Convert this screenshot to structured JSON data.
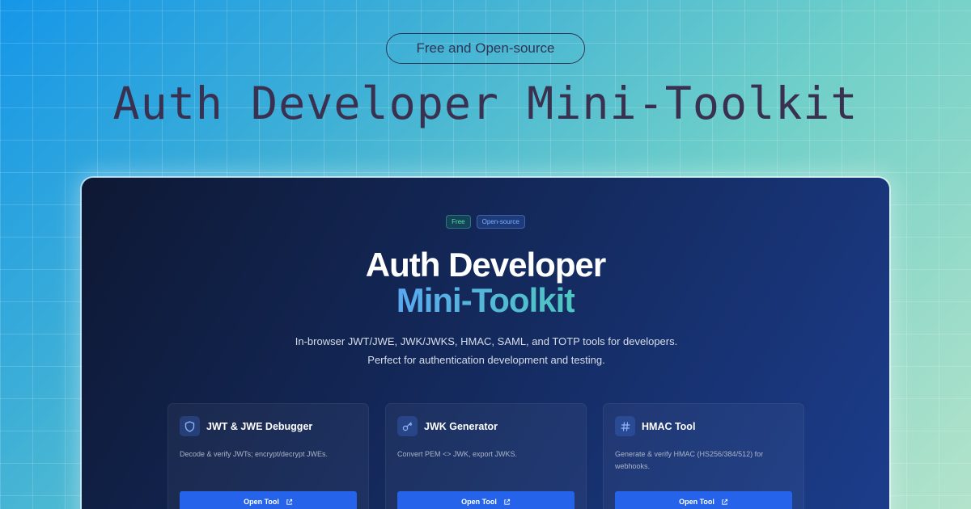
{
  "banner": {
    "pill_label": "Free and Open-source",
    "title": "Auth Developer Mini-Toolkit"
  },
  "app": {
    "badges": [
      {
        "label": "Free",
        "color": "#4fe3a0"
      },
      {
        "label": "Open-source",
        "color": "#7fb0ff"
      }
    ],
    "hero": {
      "line1": "Auth Developer",
      "line2": "Mini-Toolkit"
    },
    "description": "In-browser JWT/JWE, JWK/JWKS, HMAC, SAML, and TOTP tools for developers. Perfect for authentication development and testing.",
    "cards": [
      {
        "title": "JWT & JWE Debugger",
        "description": "Decode & verify JWTs; encrypt/decrypt JWEs.",
        "button": "Open Tool",
        "icon": "shield-icon"
      },
      {
        "title": "JWK Generator",
        "description": "Convert PEM <> JWK, export JWKS.",
        "button": "Open Tool",
        "icon": "key-icon"
      },
      {
        "title": "HMAC Tool",
        "description": "Generate & verify HMAC (HS256/384/512) for webhooks.",
        "button": "Open Tool",
        "icon": "hash-icon"
      }
    ]
  },
  "colors": {
    "accent": "#2563eb",
    "title_text": "#3a3050",
    "window_bg": "#142a5e"
  }
}
